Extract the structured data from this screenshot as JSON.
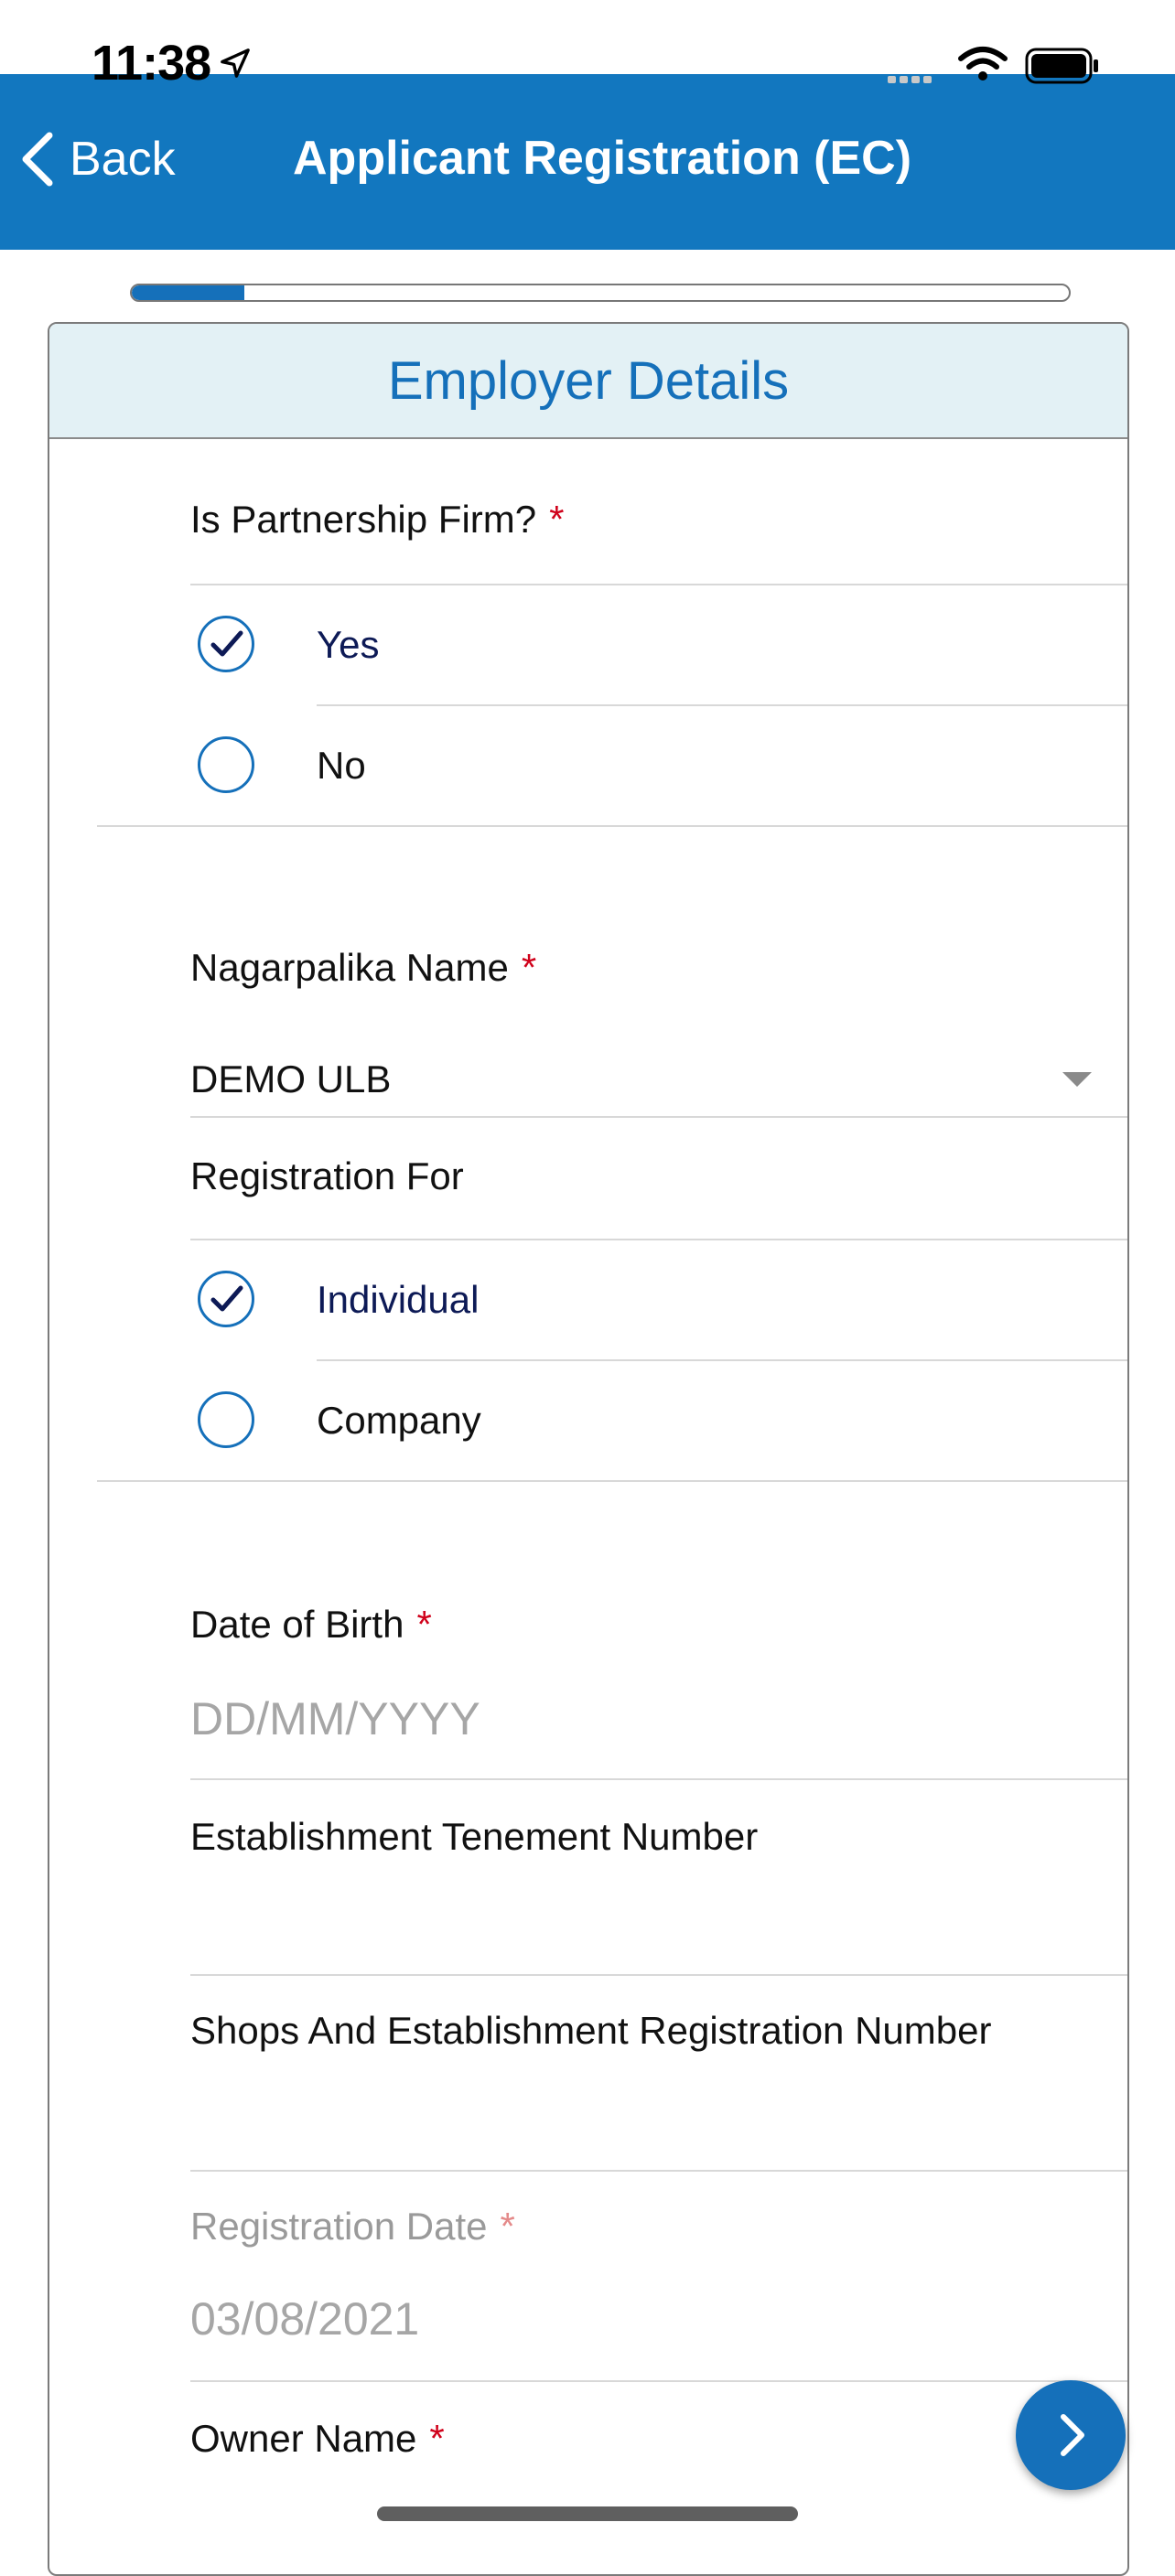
{
  "status_bar": {
    "time": "11:38",
    "icons": [
      "location-arrow-icon",
      "signal-icon",
      "wifi-icon",
      "battery-icon"
    ]
  },
  "nav": {
    "back_label": "Back",
    "title": "Applicant Registration (EC)"
  },
  "progress": {
    "fraction": 0.12
  },
  "card": {
    "title": "Employer Details"
  },
  "form": {
    "partnership": {
      "label": "Is Partnership Firm?",
      "required_mark": "*",
      "options": [
        {
          "label": "Yes",
          "selected": true
        },
        {
          "label": "No",
          "selected": false
        }
      ]
    },
    "nagarpalika": {
      "label": "Nagarpalika Name",
      "required_mark": "*",
      "value": "DEMO ULB"
    },
    "registration_for": {
      "label": "Registration For",
      "options": [
        {
          "label": "Individual",
          "selected": true
        },
        {
          "label": "Company",
          "selected": false
        }
      ]
    },
    "dob": {
      "label": "Date of Birth",
      "required_mark": "*",
      "placeholder": "DD/MM/YYYY"
    },
    "tenement": {
      "label": "Establishment Tenement Number",
      "value": ""
    },
    "shops_reg": {
      "label": "Shops And Establishment Registration Number",
      "value": ""
    },
    "registration_date": {
      "label": "Registration Date",
      "required_mark": "*",
      "value": "03/08/2021"
    },
    "owner_name": {
      "label": "Owner Name",
      "required_mark": "*"
    }
  },
  "colors": {
    "brand": "#1277bf",
    "accent": "#1570ba",
    "header_bg": "#e3f1f5",
    "required": "#d0021b"
  }
}
